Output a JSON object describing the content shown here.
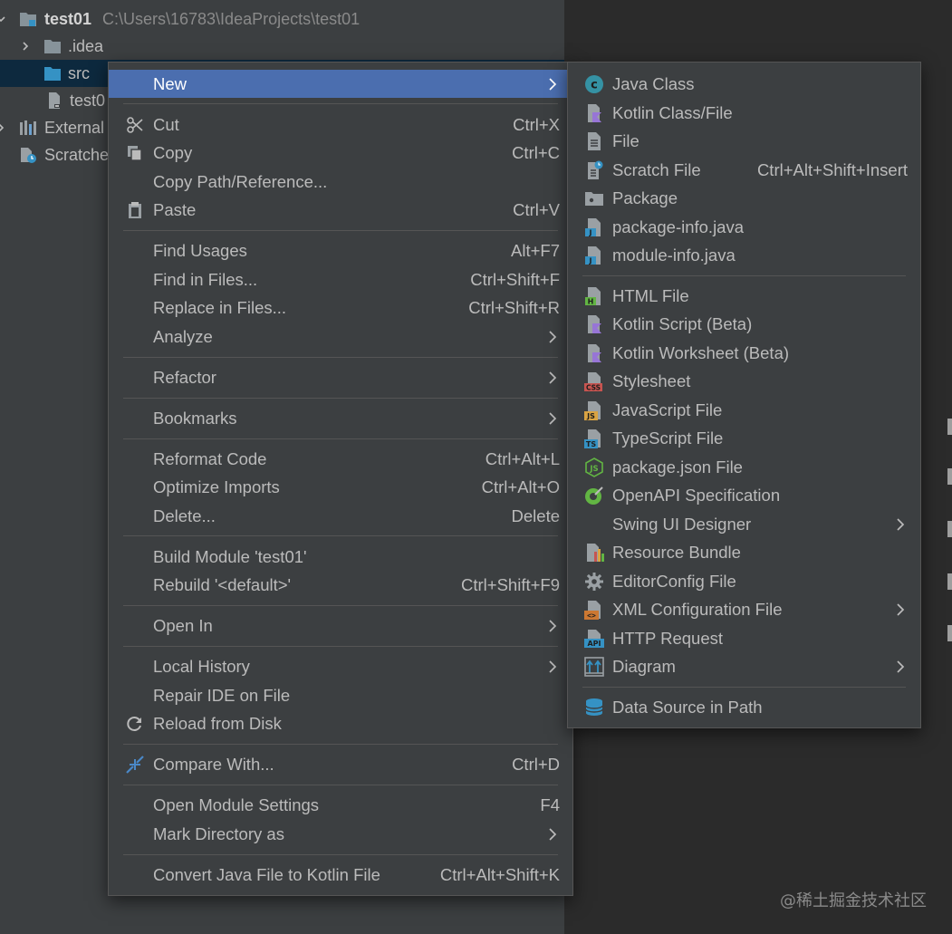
{
  "tree": {
    "root": {
      "label": "test01",
      "path": "C:\\Users\\16783\\IdeaProjects\\test01"
    },
    "idea": {
      "label": ".idea"
    },
    "src": {
      "label": "src"
    },
    "file": {
      "label": "test0"
    },
    "external": {
      "label": "External"
    },
    "scratches": {
      "label": "Scratche"
    }
  },
  "context_menu": {
    "new": {
      "label": "New"
    },
    "cut": {
      "label": "Cut",
      "shortcut": "Ctrl+X"
    },
    "copy": {
      "label": "Copy",
      "shortcut": "Ctrl+C"
    },
    "copy_path": {
      "label": "Copy Path/Reference..."
    },
    "paste": {
      "label": "Paste",
      "shortcut": "Ctrl+V"
    },
    "find_usages": {
      "label": "Find Usages",
      "shortcut": "Alt+F7"
    },
    "find_in_files": {
      "label": "Find in Files...",
      "shortcut": "Ctrl+Shift+F"
    },
    "replace_in_files": {
      "label": "Replace in Files...",
      "shortcut": "Ctrl+Shift+R"
    },
    "analyze": {
      "label": "Analyze"
    },
    "refactor": {
      "label": "Refactor"
    },
    "bookmarks": {
      "label": "Bookmarks"
    },
    "reformat_code": {
      "label": "Reformat Code",
      "shortcut": "Ctrl+Alt+L"
    },
    "optimize_imports": {
      "label": "Optimize Imports",
      "shortcut": "Ctrl+Alt+O"
    },
    "delete": {
      "label": "Delete...",
      "shortcut": "Delete"
    },
    "build_module": {
      "label": "Build Module 'test01'"
    },
    "rebuild": {
      "label": "Rebuild '<default>'",
      "shortcut": "Ctrl+Shift+F9"
    },
    "open_in": {
      "label": "Open In"
    },
    "local_history": {
      "label": "Local History"
    },
    "repair_ide": {
      "label": "Repair IDE on File"
    },
    "reload_from_disk": {
      "label": "Reload from Disk"
    },
    "compare_with": {
      "label": "Compare With...",
      "shortcut": "Ctrl+D"
    },
    "open_module_settings": {
      "label": "Open Module Settings",
      "shortcut": "F4"
    },
    "mark_directory_as": {
      "label": "Mark Directory as"
    },
    "convert_java_to_kotlin": {
      "label": "Convert Java File to Kotlin File",
      "shortcut": "Ctrl+Alt+Shift+K"
    }
  },
  "new_submenu": {
    "java_class": {
      "label": "Java Class"
    },
    "kotlin_class": {
      "label": "Kotlin Class/File"
    },
    "file": {
      "label": "File"
    },
    "scratch_file": {
      "label": "Scratch File",
      "shortcut": "Ctrl+Alt+Shift+Insert"
    },
    "package": {
      "label": "Package"
    },
    "package_info": {
      "label": "package-info.java"
    },
    "module_info": {
      "label": "module-info.java"
    },
    "html_file": {
      "label": "HTML File"
    },
    "kotlin_script": {
      "label": "Kotlin Script (Beta)"
    },
    "kotlin_worksheet": {
      "label": "Kotlin Worksheet (Beta)"
    },
    "stylesheet": {
      "label": "Stylesheet"
    },
    "javascript_file": {
      "label": "JavaScript File"
    },
    "typescript_file": {
      "label": "TypeScript File"
    },
    "package_json": {
      "label": "package.json File"
    },
    "openapi": {
      "label": "OpenAPI Specification"
    },
    "swing_ui_designer": {
      "label": "Swing UI Designer"
    },
    "resource_bundle": {
      "label": "Resource Bundle"
    },
    "editorconfig": {
      "label": "EditorConfig File"
    },
    "xml_config": {
      "label": "XML Configuration File"
    },
    "http_request": {
      "label": "HTTP Request"
    },
    "diagram": {
      "label": "Diagram"
    },
    "data_source_in_path": {
      "label": "Data Source in Path"
    }
  },
  "icon_badges": {
    "css": "CSS",
    "js": "JS",
    "ts": "TS",
    "html": "H",
    "api": "API",
    "xml": "<>",
    "java": "J"
  },
  "watermark": "@稀土掘金技术社区",
  "colors": {
    "panel_bg": "#3c3f41",
    "editor_bg": "#2b2b2b",
    "selection": "#4b6eaf",
    "tree_selection": "#0d293e",
    "text": "#bbbbbb"
  }
}
